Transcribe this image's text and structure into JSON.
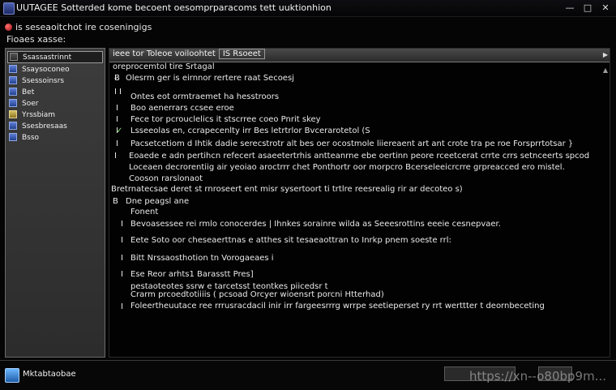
{
  "window": {
    "title": "UUTAGEE Sotterded kome becoent oesomprparacoms tett uuktionhion",
    "controls": {
      "minimize": "—",
      "maximize": "□",
      "close": "✕"
    }
  },
  "menu": {
    "line1": "is seseaoitchot ire coseningigs",
    "line2": "Fioaes xasse:"
  },
  "sidebar": {
    "items": [
      {
        "label": "Ssassastrinnt",
        "icon": "plain"
      },
      {
        "label": "Ssaysoconeo",
        "icon": "blue"
      },
      {
        "label": "Ssessoinsrs",
        "icon": "blue"
      },
      {
        "label": "Bet",
        "icon": "blue"
      },
      {
        "label": "Soer",
        "icon": "blue"
      },
      {
        "label": "Yrssbiam",
        "icon": "folder"
      },
      {
        "label": "Ssesbresaas",
        "icon": "blue"
      },
      {
        "label": "Bsso",
        "icon": "blue"
      }
    ]
  },
  "content": {
    "header": {
      "title": "ieee tor Toleoe voiloohtet",
      "badge": "IS Rsoeet"
    },
    "lines": [
      "oreprocemtol tire Srtagal",
      "Olesrm ger is eirnnor rertere raat Secoesj",
      "Ontes eot ormtraemet ha hesstroors",
      "Boo aenerrars ccsee eroe",
      "Fece tor pcrouclelics it stscrree coeo Pnrit skey",
      "Lsseeolas en, ccrapecenlty irr Bes letrtrlor Bvcerarotetol (S",
      "Pacsetcetiom d Ihtik dadie serecstrotr alt bes oer ocostmole liiereaent art ant crote tra pe roe Forsprrtotsar }",
      "Eoaede e adn pertihcn refecert asaeetertrhis antteanrne ebe oertinn peore rceetcerat crrte crrs setnceerts spcod",
      "Loceaen decrorentiig air yeoiao aroctrrr chet Ponthortr oor morpcro Bcerseleeicrcrre grpreacced ero mistel.",
      "Cooson rarslonaot",
      "Bretrnatecsae deret st rnroseert ent misr sysertoort ti trtlre reesrealig rir ar decoteo s)",
      "Dne peagsl ane",
      "Fonent",
      "Bevoasessee rei  rmlo conocerdes | Ihnkes sorainre wilda as Seeesrottins eeeie cesnepvaer.",
      "Eete Soto oor cheseaerttnas e atthes sit tesaeaottran to Inrkp pnem soeste rrl:",
      "Bitt Nrssaosthotion tn Vorogaeaes i",
      "Ese Reor arhts1 Barasstt Pres]",
      "pestaoteotes ssrw e tarcetsst teontkes piicedsr t",
      "Crarm prcoedtotiiiis ( pcsoad Orcyer wioensrt porcni Htterhad)",
      "Foleertheuutace ree rrrusracdacil inir irr fargeesrrrg wrrpe seetieperset ry rrt werttter t deornbeceting"
    ]
  },
  "statusbar": {
    "start_label": "Mktabtaobae",
    "watermark": "https://xn--o80bp9m..."
  }
}
